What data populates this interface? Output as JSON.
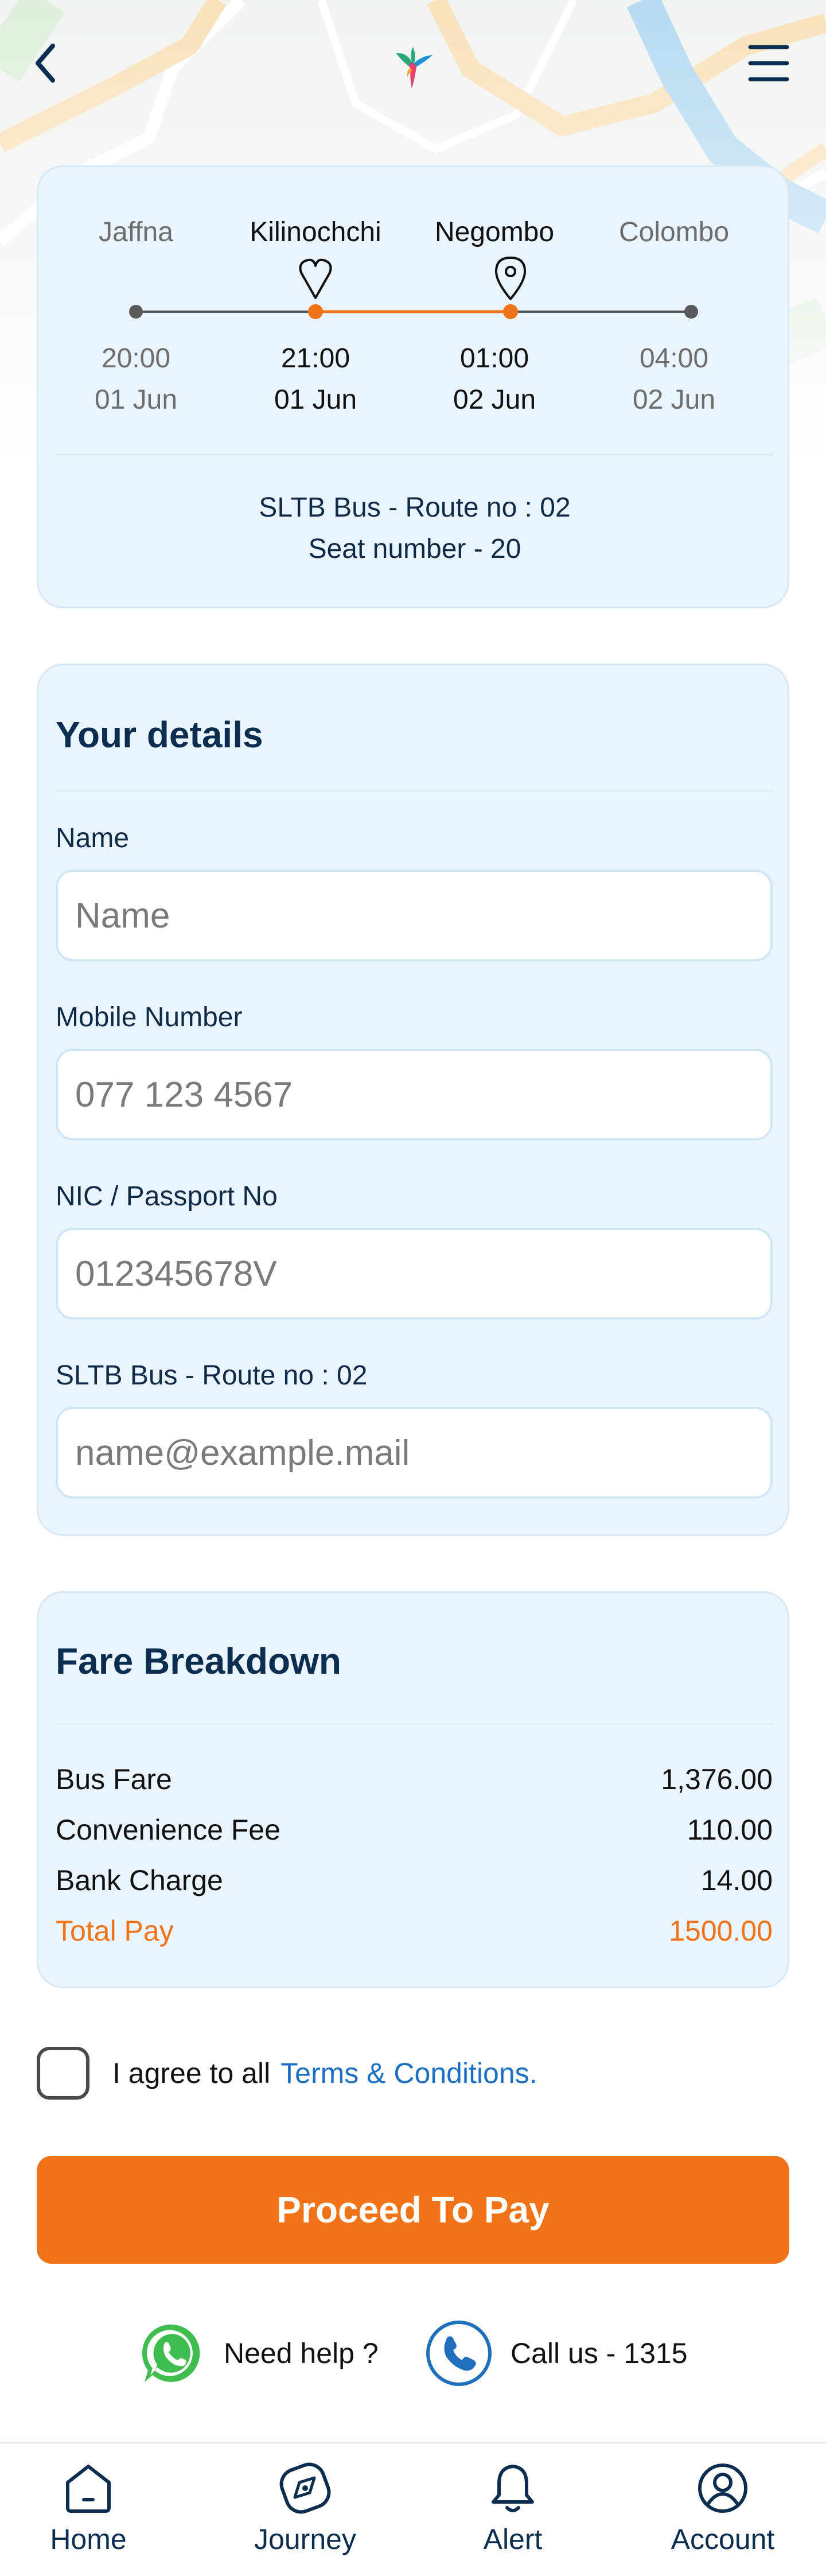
{
  "header": {
    "back_icon": "chevron-left-icon",
    "logo_icon": "hummingbird-logo",
    "menu_icon": "hamburger-menu-icon"
  },
  "route": {
    "stops": [
      {
        "name": "Jaffna",
        "time": "20:00",
        "date": "01 Jun",
        "highlight": false
      },
      {
        "name": "Kilinochchi",
        "time": "21:00",
        "date": "01 Jun",
        "highlight": true,
        "icon": "heart-pin-icon"
      },
      {
        "name": "Negombo",
        "time": "01:00",
        "date": "02 Jun",
        "highlight": true,
        "icon": "location-pin-icon"
      },
      {
        "name": "Colombo",
        "time": "04:00",
        "date": "02 Jun",
        "highlight": false
      }
    ],
    "bus_line": "SLTB Bus - Route no : 02",
    "seat_line": "Seat number - 20",
    "accent_color": "#f07317"
  },
  "details": {
    "title": "Your details",
    "fields": [
      {
        "label": "Name",
        "placeholder": "Name"
      },
      {
        "label": "Mobile Number",
        "placeholder": "077 123 4567"
      },
      {
        "label": "NIC / Passport No",
        "placeholder": "012345678V"
      },
      {
        "label": "SLTB Bus - Route no : 02",
        "placeholder": "name@example.mail"
      }
    ]
  },
  "fare": {
    "title": "Fare Breakdown",
    "rows": [
      {
        "label": "Bus Fare",
        "value": "1,376.00"
      },
      {
        "label": "Convenience Fee",
        "value": "110.00"
      },
      {
        "label": "Bank Charge",
        "value": "14.00"
      }
    ],
    "total_label": "Total Pay",
    "total_value": "1500.00"
  },
  "agreement": {
    "text": "I agree to all",
    "link": "Terms & Conditions."
  },
  "proceed_label": "Proceed To Pay",
  "help": {
    "need_help": "Need help ?",
    "call_us": "Call us - 1315",
    "whatsapp_icon": "whatsapp-icon",
    "phone_icon": "phone-icon"
  },
  "nav": [
    {
      "label": "Home",
      "icon": "home-icon"
    },
    {
      "label": "Journey",
      "icon": "compass-icon"
    },
    {
      "label": "Alert",
      "icon": "bell-icon"
    },
    {
      "label": "Account",
      "icon": "user-circle-icon"
    }
  ]
}
